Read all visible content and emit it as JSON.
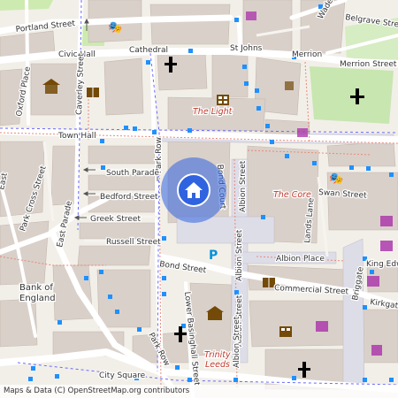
{
  "map": {
    "colors": {
      "background": "#f2efe9",
      "building": "#d9d0c9",
      "road_major": "#ffffff",
      "pedestrian": "#dddde8",
      "green": "#cdebb0",
      "bus_stop": "#1e90ff",
      "location_marker": "#2f63e0",
      "poi_red": "#c0392b",
      "shop_purple": "#ac39ac",
      "amenity_brown": "#734a08"
    },
    "streets": {
      "portland_street": "Portland Street",
      "civic_hall": "Civic Hall",
      "cathedral": "Cathedral",
      "st_johns": "St Johns",
      "merrion": "Merrion",
      "merrion_street": "Merrion Street",
      "belgrave_street": "Belgrave Street",
      "wade_lane": "Wade La...",
      "oxford_place": "Oxford Place",
      "caverley_street": "Caverley Street",
      "town_hall": "Town Hall",
      "park_row": "Park Row",
      "south_parade": "South Parade",
      "bedford_street": "Bedford Street",
      "greek_street": "Greek Street",
      "russell_street": "Russell Street",
      "park_cross_street": "Park Cross Street",
      "east_parade": "East Parade",
      "bond_street": "Bond Street",
      "lower_basinghall_street": "Lower Basinghall Street",
      "albion_street": "Albion Street",
      "albion_street_2": "Albion Street",
      "albion_street_3": "Albion Street",
      "albion_place": "Albion Place",
      "commercial_street": "Commercial Street",
      "lands_lane": "Lands Lane",
      "swan_street": "Swan Street",
      "briggate": "Briggate",
      "king_edward": "King Edw...",
      "kirkgate": "Kirkgate",
      "city_square": "City Square",
      "bond_court": "Bond Court",
      "east": "East",
      "park_row_2": "Park Row"
    },
    "places": {
      "the_light": "The Light",
      "the_core": "The Core",
      "trinity_leeds_1": "Trinity",
      "trinity_leeds_2": "Leeds",
      "bank_of_england_1": "Bank of",
      "bank_of_england_2": "England"
    },
    "attribution": "Maps & Data (C) OpenStreetMap.org contributors"
  }
}
